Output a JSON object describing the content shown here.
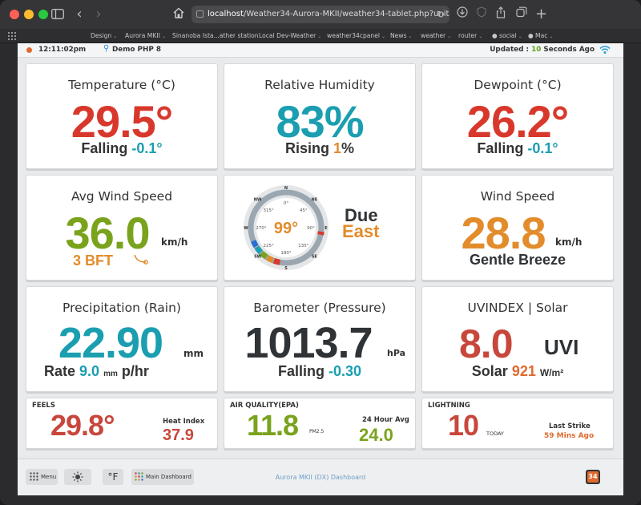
{
  "browser": {
    "url_host": "localhost",
    "url_path": "/Weather34-Aurora-MKII/weather34-tablet.php?units=metric",
    "bookmarks": [
      {
        "label": "Design",
        "has_menu": true
      },
      {
        "label": "Aurora MKII",
        "has_menu": true
      },
      {
        "label": "Sinanoba Ista...ather station",
        "has_menu": false
      },
      {
        "label": "Local Dev-Weather",
        "has_menu": true
      },
      {
        "label": "weather34cpanel",
        "has_menu": true
      },
      {
        "label": "News",
        "has_menu": true
      },
      {
        "label": "weather",
        "has_menu": true
      },
      {
        "label": "router",
        "has_menu": true
      },
      {
        "label": "social",
        "has_menu": true
      },
      {
        "label": "Mac",
        "has_menu": true
      }
    ]
  },
  "header": {
    "time": "12:11:02pm",
    "station": "Demo PHP 8",
    "updated_prefix": "Updated :",
    "updated_value": "10",
    "updated_suffix": "Seconds Ago",
    "status_color": "#e0692e"
  },
  "temperature": {
    "title": "Temperature (°C)",
    "value": "29.5°",
    "trend": "Falling",
    "change": "-0.1°"
  },
  "humidity": {
    "title": "Relative Humidity",
    "value": "83%",
    "trend": "Rising",
    "change": "1",
    "change_unit": "%"
  },
  "dewpoint": {
    "title": "Dewpoint (°C)",
    "value": "26.2°",
    "trend": "Falling",
    "change": "-0.1°"
  },
  "avg_wind": {
    "title": "Avg Wind Speed",
    "value": "36.0",
    "unit": "km/h",
    "bft": "3 BFT"
  },
  "compass": {
    "direction_value": "99°",
    "direction_deg": 99,
    "label_line1": "Due",
    "label_line2": "East",
    "cardinals": [
      "N",
      "NE",
      "E",
      "SE",
      "S",
      "SW",
      "W",
      "NW"
    ],
    "degree_labels": [
      "0°",
      "45°",
      "90°",
      "135°",
      "180°",
      "225°",
      "270°",
      "315°"
    ]
  },
  "wind_speed": {
    "title": "Wind Speed",
    "value": "28.8",
    "unit": "km/h",
    "description": "Gentle Breeze"
  },
  "rain": {
    "title": "Precipitation (Rain)",
    "value": "22.90",
    "unit": "mm",
    "rate_label": "Rate",
    "rate_value": "9.0",
    "rate_unit_small": "mm",
    "rate_unit": "p/hr"
  },
  "barometer": {
    "title": "Barometer (Pressure)",
    "value": "1013.7",
    "unit": "hPa",
    "trend": "Falling",
    "change": "-0.30"
  },
  "uv": {
    "title": "UVINDEX | Solar",
    "value": "8.0",
    "unit": "UVI",
    "solar_label": "Solar",
    "solar_value": "921",
    "solar_unit": "W/m²"
  },
  "feels": {
    "title": "FEELS",
    "value": "29.8°",
    "heat_label": "Heat Index",
    "heat_value": "37.9"
  },
  "air": {
    "title": "AIR QUALITY(EPA)",
    "value": "11.8",
    "unit": "PM2.5",
    "avg_label": "24 Hour Avg",
    "avg_value": "24.0"
  },
  "lightning": {
    "title": "LIGHTNING",
    "value": "10",
    "unit": "TODAY",
    "last_label": "Last Strike",
    "last_value": "59 Mins Ago"
  },
  "footer": {
    "menu": "Menu",
    "unit_toggle": "°F",
    "dashboard": "Main Dashboard",
    "center": "Aurora MKII (DX) Dashboard",
    "logo_text": "34"
  },
  "colors": {
    "red": "#d8382c",
    "teal": "#1a9eb0",
    "green": "#7aa31d",
    "orange": "#e28c2b",
    "dark": "#2f3336",
    "brick": "#c8473c"
  }
}
